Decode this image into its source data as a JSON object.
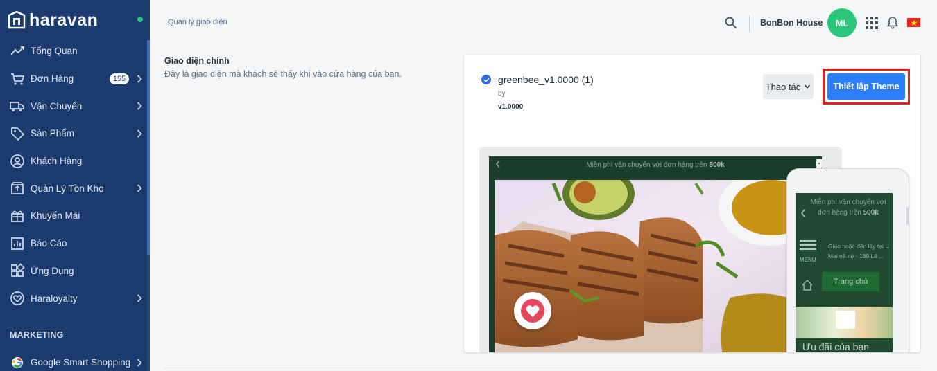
{
  "brand": {
    "name": "haravan"
  },
  "sidebar": {
    "items": [
      {
        "label": "Tổng Quan",
        "icon": "chart-line-icon",
        "has_children": false
      },
      {
        "label": "Đơn Hàng",
        "icon": "cart-icon",
        "badge": "155",
        "has_children": true
      },
      {
        "label": "Vận Chuyển",
        "icon": "truck-icon",
        "has_children": true
      },
      {
        "label": "Sản Phẩm",
        "icon": "tag-icon",
        "has_children": true
      },
      {
        "label": "Khách Hàng",
        "icon": "user-circle-icon",
        "has_children": false
      },
      {
        "label": "Quản Lý Tồn Kho",
        "icon": "box-icon",
        "has_children": true
      },
      {
        "label": "Khuyến Mãi",
        "icon": "gift-icon",
        "has_children": false
      },
      {
        "label": "Báo Cáo",
        "icon": "report-icon",
        "has_children": false
      },
      {
        "label": "Ứng Dụng",
        "icon": "apps-icon",
        "has_children": false
      },
      {
        "label": "Haraloyalty",
        "icon": "heart-circle-icon",
        "has_children": true
      }
    ],
    "section_marketing": "MARKETING",
    "marketing_items": [
      {
        "label": "Google Smart Shopping",
        "icon": "google-icon",
        "has_children": true
      }
    ]
  },
  "header": {
    "breadcrumb": "Quản lý giao diện",
    "store_name": "BonBon House",
    "avatar_initials": "ML",
    "avatar_color": "#29c57a"
  },
  "main": {
    "section_title": "Giao diện chính",
    "section_desc": "Đây là giao diện mà khách sẽ thấy khi vào cửa hàng của bạn.",
    "theme": {
      "name": "greenbee_v1.0000 (1)",
      "by_label": "by",
      "version": "v1.0000"
    },
    "actions_label": "Thao tác",
    "setup_button_label": "Thiết lập Theme",
    "accent_color": "#2d7ff9",
    "highlight_color": "#e02424",
    "preview": {
      "desktop_promo_text": "Miễn phí vận chuyển với đơn hàng trên",
      "desktop_promo_amount": "500k",
      "mobile_promo_text": "Miễn phí vận chuyển với đơn hàng trên",
      "mobile_promo_amount": "500k",
      "mobile_menu_label": "MENU",
      "mobile_address": "Giao hoặc đến lấy tại ⌄ Mai nê nè - 189 Lê ...",
      "mobile_home_button": "Trang chủ",
      "mobile_offer_text": "Ưu đãi của bạn"
    }
  }
}
